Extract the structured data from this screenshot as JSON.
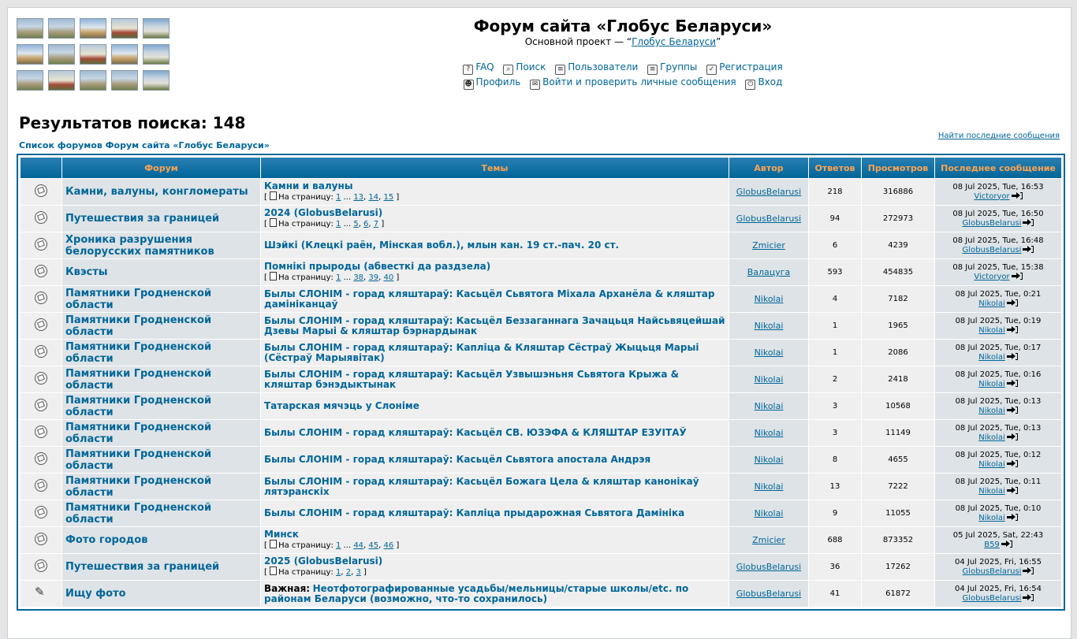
{
  "header": {
    "title": "Форум сайта «Глобус Беларуси»",
    "subtitle_prefix": "Основной проект — “",
    "subtitle_link": "Глобус Беларуси",
    "subtitle_suffix": "”"
  },
  "nav": {
    "row1": [
      {
        "label": "FAQ",
        "icon": "faq-icon"
      },
      {
        "label": "Поиск",
        "icon": "search-icon"
      },
      {
        "label": "Пользователи",
        "icon": "members-icon"
      },
      {
        "label": "Группы",
        "icon": "groups-icon"
      },
      {
        "label": "Регистрация",
        "icon": "register-icon"
      }
    ],
    "row2": [
      {
        "label": "Профиль",
        "icon": "profile-icon"
      },
      {
        "label": "Войти и проверить личные сообщения",
        "icon": "messages-icon"
      },
      {
        "label": "Вход",
        "icon": "login-icon"
      }
    ]
  },
  "results_title": "Результатов поиска: 148",
  "breadcrumb": "Список форумов Форум сайта «Глобус Беларуси»",
  "latest_link": "Найти последние сообщения",
  "columns": {
    "forum": "Форум",
    "topics": "Темы",
    "author": "Автор",
    "replies": "Ответов",
    "views": "Просмотров",
    "last": "Последнее сообщение"
  },
  "rows": [
    {
      "forum": "Камни, валуны, конгломераты",
      "topic": "Камни и валуны",
      "pages": [
        "1",
        "13",
        "14",
        "15"
      ],
      "author": "GlobusBelarusi",
      "replies": "218",
      "views": "316886",
      "last_date": "08 Jul 2025, Tue, 16:53",
      "last_user": "Victoryor"
    },
    {
      "forum": "Путешествия за границей",
      "topic": "2024 (GlobusBelarusi)",
      "pages": [
        "1",
        "5",
        "6",
        "7"
      ],
      "author": "GlobusBelarusi",
      "replies": "94",
      "views": "272973",
      "last_date": "08 Jul 2025, Tue, 16:50",
      "last_user": "GlobusBelarusi"
    },
    {
      "forum": "Хроника разрушения белорусских памятников",
      "topic": "Шэйкі (Клецкі раён, Мінская вобл.), млын кан. 19 ст.-пач. 20 ст.",
      "pages": [],
      "author": "Zmicier",
      "replies": "6",
      "views": "4239",
      "last_date": "08 Jul 2025, Tue, 16:48",
      "last_user": "GlobusBelarusi"
    },
    {
      "forum": "Квэсты",
      "topic": "Помнікі прыроды (абвесткі да раздзела)",
      "pages": [
        "1",
        "38",
        "39",
        "40"
      ],
      "author": "Валацуга",
      "replies": "593",
      "views": "454835",
      "last_date": "08 Jul 2025, Tue, 15:38",
      "last_user": "Victoryor"
    },
    {
      "forum": "Памятники Гродненской области",
      "topic": "Былы СЛОНІМ - горад кляштараў: Касьцёл Сьвятога Міхала Арханёла & кляштар даміні­канцаў",
      "pages": [],
      "author": "Nikolai",
      "replies": "4",
      "views": "7182",
      "last_date": "08 Jul 2025, Tue, 0:21",
      "last_user": "Nikolai"
    },
    {
      "forum": "Памятники Гродненской области",
      "topic": "Былы СЛОНІМ - горад кляштараў: Касьцёл Беззаганнага Зачацьця Найсьвяцейшай Дзевы Марыі & кляштар бэрнардынак",
      "pages": [],
      "author": "Nikolai",
      "replies": "1",
      "views": "1965",
      "last_date": "08 Jul 2025, Tue, 0:19",
      "last_user": "Nikolai"
    },
    {
      "forum": "Памятники Гродненской области",
      "topic": "Былы СЛОНІМ - горад кляштараў: Капліца & Кляштар Сёстраў Жыцьця Марыі (Сёстраў Марыявітак)",
      "pages": [],
      "author": "Nikolai",
      "replies": "1",
      "views": "2086",
      "last_date": "08 Jul 2025, Tue, 0:17",
      "last_user": "Nikolai"
    },
    {
      "forum": "Памятники Гродненской области",
      "topic": "Былы СЛОНІМ - горад кляштараў: Касьцёл Узвышэньня Сьвятога Крыжа & кляштар бэнэдыктынак",
      "pages": [],
      "author": "Nikolai",
      "replies": "2",
      "views": "2418",
      "last_date": "08 Jul 2025, Tue, 0:16",
      "last_user": "Nikolai"
    },
    {
      "forum": "Памятники Гродненской области",
      "topic": "Татарская мячэць у Слоніме",
      "pages": [],
      "author": "Nikolai",
      "replies": "3",
      "views": "10568",
      "last_date": "08 Jul 2025, Tue, 0:13",
      "last_user": "Nikolai"
    },
    {
      "forum": "Памятники Гродненской области",
      "topic": "Былы СЛОНІМ - горад кляштараў: Касьцёл СВ. ЮЗЭФА & КЛЯШТАР ЕЗУІТАЎ",
      "pages": [],
      "author": "Nikolai",
      "replies": "3",
      "views": "11149",
      "last_date": "08 Jul 2025, Tue, 0:13",
      "last_user": "Nikolai"
    },
    {
      "forum": "Памятники Гродненской области",
      "topic": "Былы СЛОНІМ - горад кляштараў: Касьцёл Сьвятога апостала Андрэя",
      "pages": [],
      "author": "Nikolai",
      "replies": "8",
      "views": "4655",
      "last_date": "08 Jul 2025, Tue, 0:12",
      "last_user": "Nikolai"
    },
    {
      "forum": "Памятники Гродненской области",
      "topic": "Былы СЛОНІМ - горад кляштараў: Касьцёл Божага Цела & кляштар канонікаў лятэранскіх",
      "pages": [],
      "author": "Nikolai",
      "replies": "13",
      "views": "7222",
      "last_date": "08 Jul 2025, Tue, 0:11",
      "last_user": "Nikolai"
    },
    {
      "forum": "Памятники Гродненской области",
      "topic": "Былы СЛОНІМ - горад кляштараў: Капліца прыдарожная Сьвятога Даміні­ка",
      "pages": [],
      "author": "Nikolai",
      "replies": "9",
      "views": "11055",
      "last_date": "08 Jul 2025, Tue, 0:10",
      "last_user": "Nikolai"
    },
    {
      "forum": "Фото городов",
      "topic": "Минск",
      "pages": [
        "1",
        "44",
        "45",
        "46"
      ],
      "author": "Zmicier",
      "replies": "688",
      "views": "873352",
      "last_date": "05 Jul 2025, Sat, 22:43",
      "last_user": "B59"
    },
    {
      "forum": "Путешествия за границей",
      "topic": "2025 (GlobusBelarusi)",
      "pages": [
        "1",
        "2",
        "3"
      ],
      "author": "GlobusBelarusi",
      "replies": "36",
      "views": "17262",
      "last_date": "04 Jul 2025, Fri, 16:55",
      "last_user": "GlobusBelarusi"
    },
    {
      "forum": "Ищу фото",
      "important": "Важная:",
      "topic": "Неотфотографированные усадьбы/мельницы/старые школы/etc. по районам Беларуси (возможно, что-то сохранилось)",
      "pages": [],
      "author": "GlobusBelarusi",
      "replies": "41",
      "views": "61872",
      "last_date": "04 Jul 2025, Fri, 16:54",
      "last_user": "GlobusBelarusi",
      "pinned": true
    }
  ],
  "pager_text": {
    "label": "На страницу:",
    "dots": "...",
    "open": "[",
    "close": "]"
  }
}
